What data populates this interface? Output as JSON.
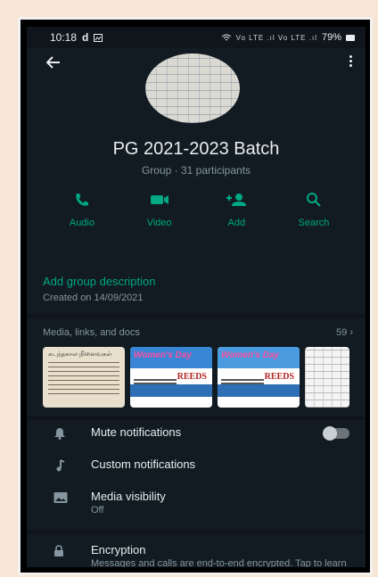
{
  "status_bar": {
    "time": "10:18",
    "carrier_mark": "d",
    "signal_text": "Vo LTE .ıl Vo LTE .ıl",
    "battery": "79%"
  },
  "header": {
    "group_name": "PG 2021-2023 Batch",
    "group_meta": "Group · 31 participants"
  },
  "actions": [
    {
      "label": "Audio",
      "icon": "phone-icon"
    },
    {
      "label": "Video",
      "icon": "video-icon"
    },
    {
      "label": "Add",
      "icon": "add-person-icon"
    },
    {
      "label": "Search",
      "icon": "search-icon"
    }
  ],
  "description": {
    "title": "Add group description",
    "created": "Created on 14/09/2021"
  },
  "media": {
    "heading": "Media, links, and docs",
    "count": "59 ›",
    "thumbs": [
      {
        "title": "கடந்தகால நினைவுகள்"
      },
      {
        "title": "Women's Day",
        "brand": "REEDS"
      },
      {
        "title": "Women's Day",
        "brand": "REEDS"
      },
      {
        "title": ""
      }
    ]
  },
  "settings": {
    "mute": "Mute notifications",
    "custom": "Custom notifications",
    "media_visibility": "Media visibility",
    "media_visibility_value": "Off",
    "mute_enabled": false
  },
  "encryption": {
    "title": "Encryption",
    "text": "Messages and calls are end-to-end encrypted. Tap to learn more."
  },
  "colors": {
    "accent": "#00a884",
    "background": "#111b21",
    "text_secondary": "#8696a0"
  }
}
